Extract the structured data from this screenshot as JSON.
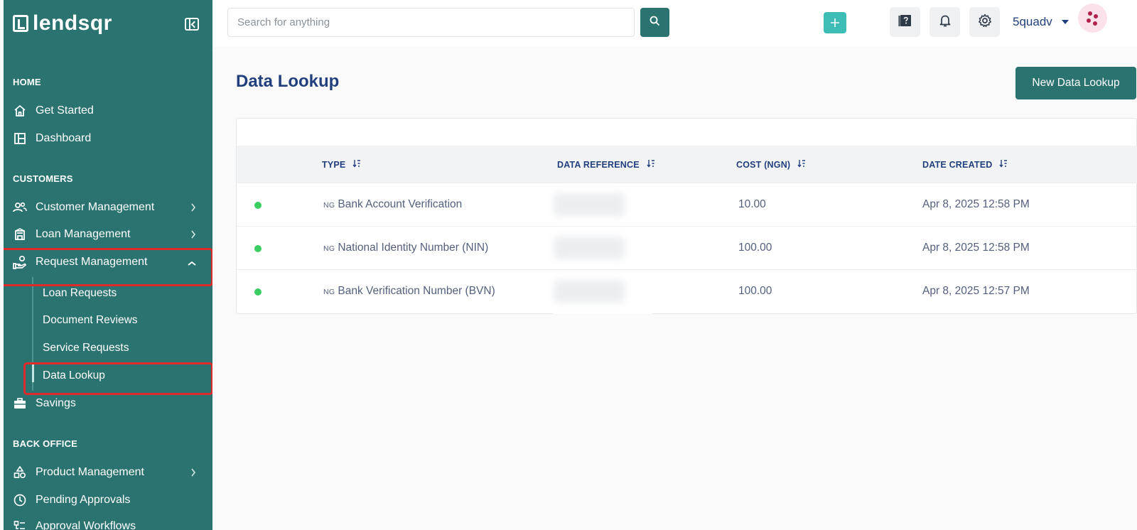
{
  "sidebar": {
    "logo_text": "lendsqr",
    "sections": {
      "home": "HOME",
      "customers": "CUSTOMERS",
      "back_office": "BACK OFFICE"
    },
    "items": {
      "get_started": "Get Started",
      "dashboard": "Dashboard",
      "customer_management": "Customer Management",
      "loan_management": "Loan Management",
      "request_management": "Request Management",
      "loan_requests": "Loan Requests",
      "document_reviews": "Document Reviews",
      "service_requests": "Service Requests",
      "data_lookup": "Data Lookup",
      "savings": "Savings",
      "product_management": "Product Management",
      "pending_approvals": "Pending Approvals",
      "approval_workflows": "Approval Workflows"
    },
    "active_item": "data_lookup",
    "accent_color": "#2a7370",
    "highlight_color": "#e02a2a"
  },
  "header": {
    "search_placeholder": "Search for anything",
    "username": "5quadv",
    "icons": [
      "search-icon",
      "plus-icon",
      "help-book-icon",
      "bell-icon",
      "gear-icon"
    ]
  },
  "main": {
    "title": "Data Lookup",
    "new_button": "New Data Lookup",
    "columns": {
      "type": "TYPE",
      "data_reference": "DATA REFERENCE",
      "cost": "COST (NGN)",
      "date_created": "DATE CREATED"
    },
    "rows": [
      {
        "country": "NG",
        "type": "Bank Account Verification",
        "cost": "10.00",
        "date": "Apr 8, 2025 12:58 PM",
        "status_color": "#39cd62"
      },
      {
        "country": "NG",
        "type": "National Identity Number (NIN)",
        "cost": "100.00",
        "date": "Apr 8, 2025 12:58 PM",
        "status_color": "#39cd62"
      },
      {
        "country": "NG",
        "type": "Bank Verification Number (BVN)",
        "cost": "100.00",
        "date": "Apr 8, 2025 12:57 PM",
        "status_color": "#39cd62"
      }
    ]
  }
}
